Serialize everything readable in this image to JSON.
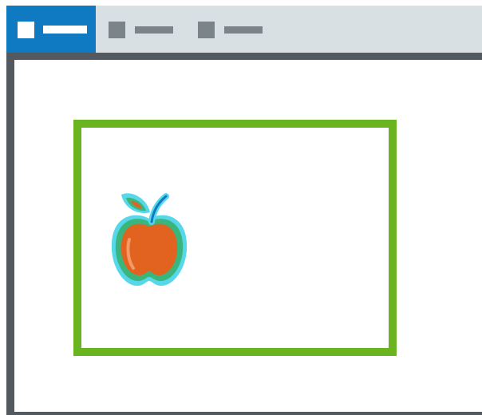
{
  "colors": {
    "accent": "#0f7ac2",
    "tabbar_bg": "#d9e0e3",
    "inactive_tab": "#7a8489",
    "window_frame": "#525a5f",
    "selection_frame": "#6ab41f"
  },
  "tabs": [
    {
      "icon": "document-icon",
      "state": "active"
    },
    {
      "icon": "document-icon",
      "state": "inactive"
    },
    {
      "icon": "document-icon",
      "state": "inactive"
    }
  ],
  "canvas": {
    "image": {
      "icon": "apple-icon"
    }
  }
}
